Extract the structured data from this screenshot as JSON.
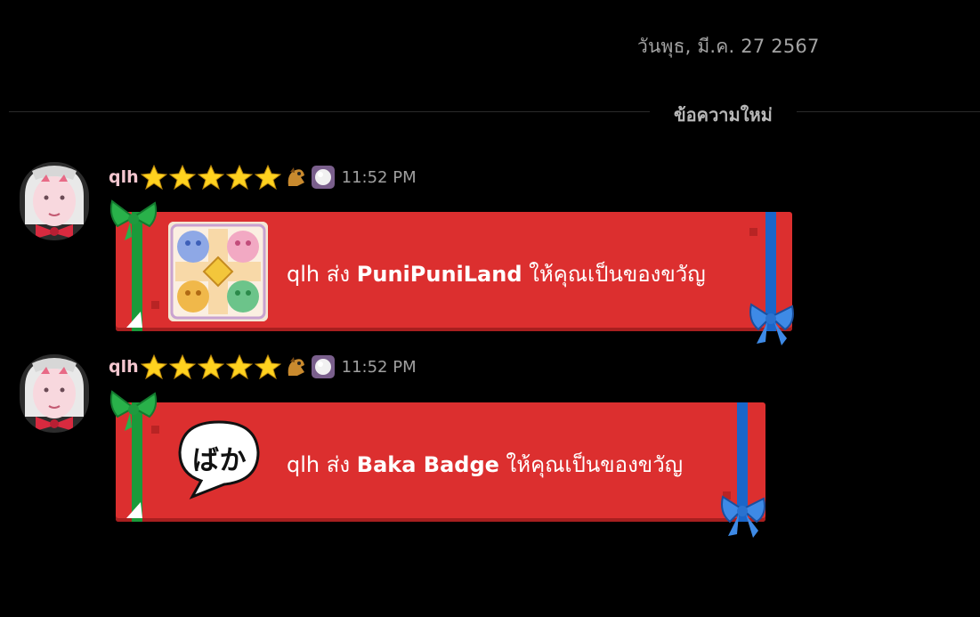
{
  "date_label": "วันพุธ, มี.ค. 27 2567",
  "divider": {
    "label": "ข้อความใหม่"
  },
  "messages": [
    {
      "username": "qlh",
      "time": "11:52 PM",
      "gift": {
        "sender": "qlh",
        "verb": "ส่ง",
        "item": "PuniPuniLand",
        "suffix": "ให้คุณเป็นของขวัญ"
      }
    },
    {
      "username": "qlh",
      "time": "11:52 PM",
      "gift": {
        "sender": "qlh",
        "verb": "ส่ง",
        "item": "Baka Badge",
        "suffix": "ให้คุณเป็นของขวัญ",
        "badge_text": "ばか"
      }
    }
  ],
  "colors": {
    "card": "#dc2f2f",
    "ribbon_green": "#1a9a3a",
    "ribbon_blue": "#1a66c9",
    "username": "#f4c6cf"
  }
}
